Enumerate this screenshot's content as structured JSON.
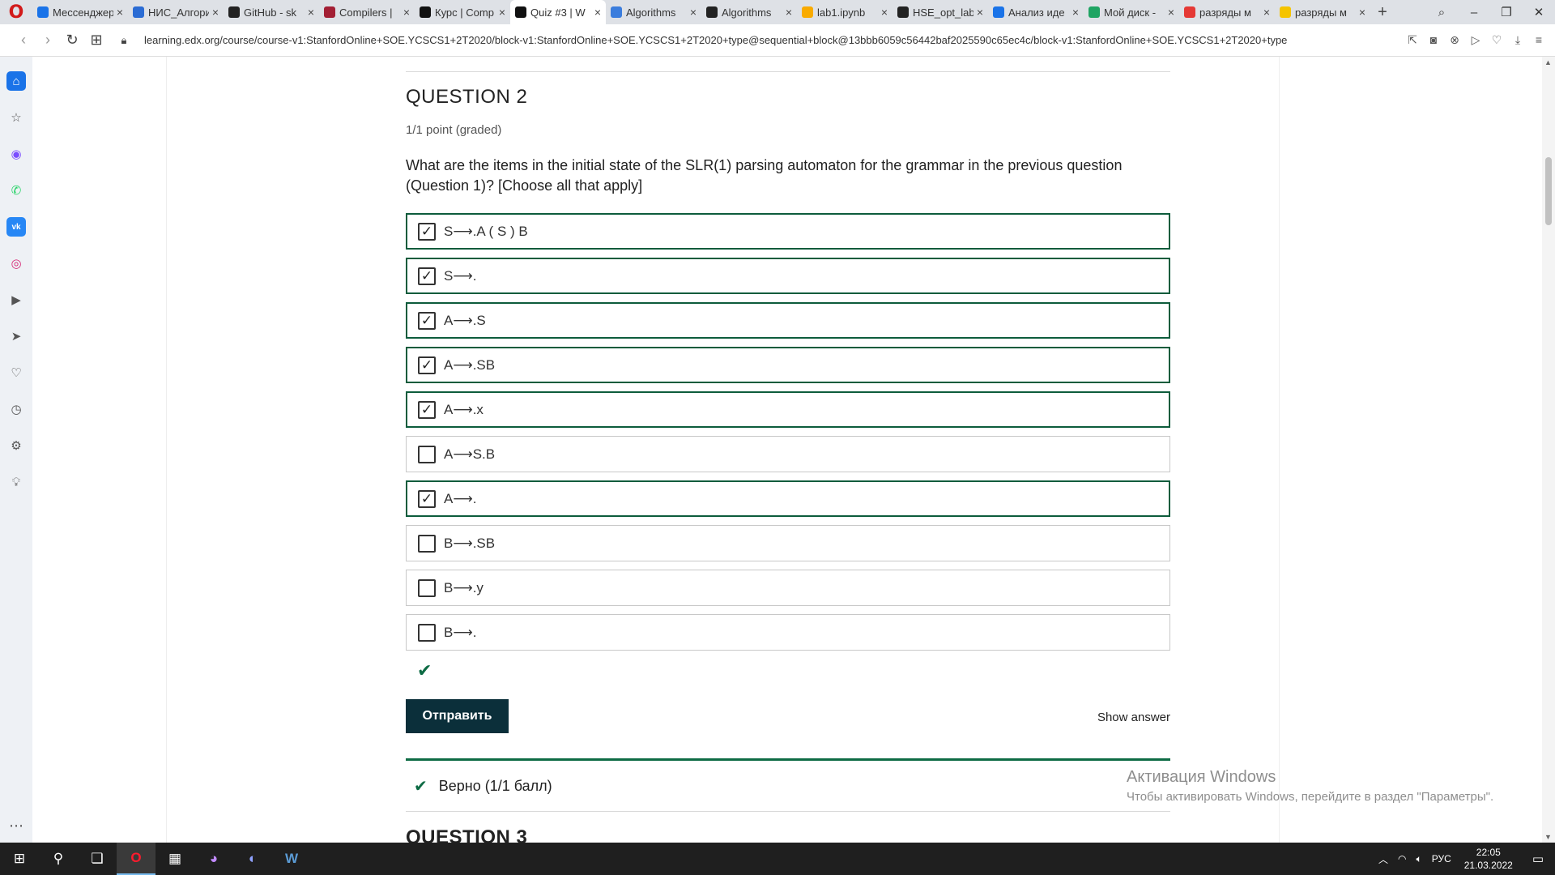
{
  "browser": {
    "tabs": [
      {
        "label": "Мессенджер",
        "color": "#1a73e8",
        "active": false
      },
      {
        "label": "НИС_Алгоритмы",
        "color": "#2b6cd4",
        "active": false
      },
      {
        "label": "GitHub - sk",
        "color": "#222222",
        "active": false
      },
      {
        "label": "Compilers |",
        "color": "#a31f34",
        "active": false
      },
      {
        "label": "Курс | Comp",
        "color": "#111111",
        "active": false
      },
      {
        "label": "Quiz #3 | W",
        "color": "#111111",
        "active": true
      },
      {
        "label": "Algorithms",
        "color": "#3b7ddd",
        "active": false
      },
      {
        "label": "Algorithms",
        "color": "#222222",
        "active": false
      },
      {
        "label": "lab1.ipynb",
        "color": "#f9ab00",
        "active": false
      },
      {
        "label": "HSE_opt_lab",
        "color": "#222222",
        "active": false
      },
      {
        "label": "Анализ иде",
        "color": "#1a73e8",
        "active": false
      },
      {
        "label": "Мой диск -",
        "color": "#1fa463",
        "active": false
      },
      {
        "label": "разряды м",
        "color": "#e53935",
        "active": false
      },
      {
        "label": "разряды м",
        "color": "#f5c400",
        "active": false
      }
    ],
    "tab_close": "×",
    "new_tab": "+",
    "url": "learning.edx.org/course/course-v1:StanfordOnline+SOE.YCSCS1+2T2020/block-v1:StanfordOnline+SOE.YCSCS1+2T2020+type@sequential+block@13bbb6059c56442baf2025590c65ec4c/block-v1:StanfordOnline+SOE.YCSCS1+2T2020+type"
  },
  "question": {
    "title": "QUESTION 2",
    "points": "1/1 point (graded)",
    "text": "What are the items in the initial state of the SLR(1) parsing automaton for the grammar in the previous question (Question 1)? [Choose all that apply]",
    "options": [
      {
        "label": "S⟶.A ( S ) B",
        "checked": true
      },
      {
        "label": "S⟶.",
        "checked": true
      },
      {
        "label": "A⟶.S",
        "checked": true
      },
      {
        "label": "A⟶.SB",
        "checked": true
      },
      {
        "label": "A⟶.x",
        "checked": true
      },
      {
        "label": "A⟶S.B",
        "checked": false
      },
      {
        "label": "A⟶.",
        "checked": true
      },
      {
        "label": "B⟶.SB",
        "checked": false
      },
      {
        "label": "B⟶.y",
        "checked": false
      },
      {
        "label": "B⟶.",
        "checked": false
      }
    ],
    "submit_label": "Отправить",
    "show_answer_label": "Show answer",
    "result_text": "Верно (1/1 балл)"
  },
  "next_question_title": "QUESTION 3",
  "watermark": {
    "line1": "Активация Windows",
    "line2": "Чтобы активировать Windows, перейдите в раздел \"Параметры\"."
  },
  "taskbar": {
    "lang": "РУС",
    "time": "22:05",
    "date": "21.03.2022"
  },
  "colors": {
    "selected_border": "#0d5c3c",
    "correct_green": "#0d6b44",
    "submit_bg": "#0b2f3a"
  }
}
